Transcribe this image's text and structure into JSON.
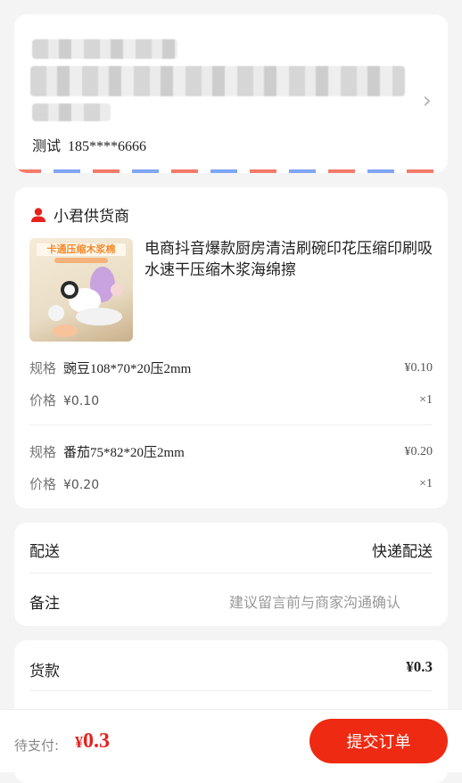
{
  "address": {
    "contact_name": "测试",
    "phone": "185****6666"
  },
  "shop": {
    "name": "小君供货商",
    "product": {
      "title": "电商抖音爆款厨房清洁刷碗印花压缩印刷吸水速干压缩木浆海绵擦",
      "thumb_banner": "卡通压缩木浆棉"
    },
    "spec_label": "规格",
    "price_label": "价格",
    "items": [
      {
        "spec": "豌豆108*70*20压2mm",
        "spec_price": "¥0.10",
        "price": "¥0.10",
        "qty": "×1"
      },
      {
        "spec": "番茄75*82*20压2mm",
        "spec_price": "¥0.20",
        "price": "¥0.20",
        "qty": "×1"
      }
    ]
  },
  "delivery": {
    "label": "配送",
    "value": "快递配送",
    "note_label": "备注",
    "note_placeholder": "建议留言前与商家沟通确认"
  },
  "payment": {
    "goods_label": "货款",
    "goods_value": "¥0.3"
  },
  "footer": {
    "to_pay_label": "待支付:",
    "currency": "¥",
    "amount": "0.3",
    "submit_label": "提交订单"
  },
  "colors": {
    "accent": "#ee2a12",
    "price_red": "#e8201b"
  }
}
